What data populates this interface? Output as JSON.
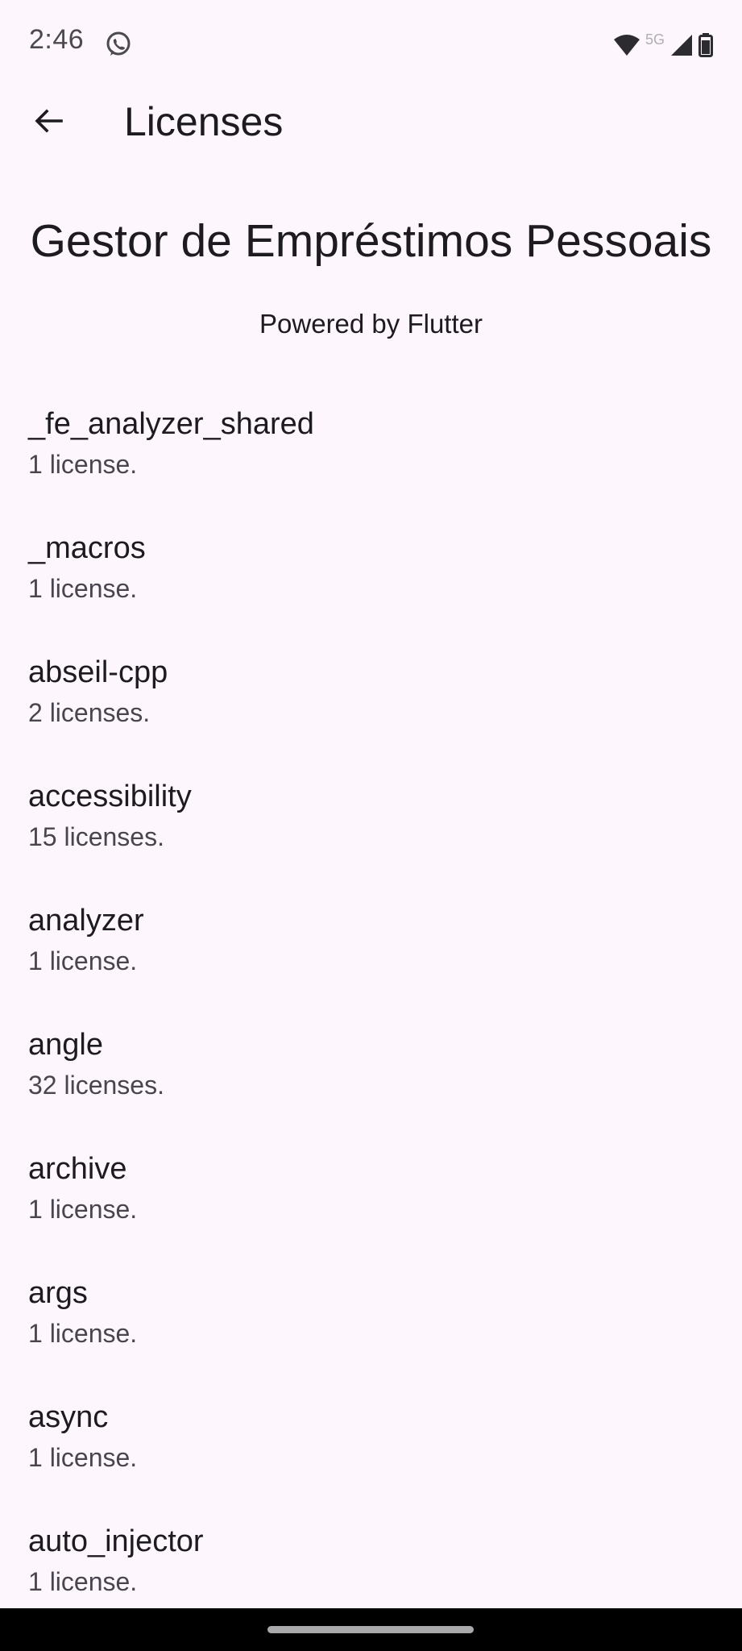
{
  "status_bar": {
    "time": "2:46",
    "app_icon": "whatsapp-icon",
    "network_label": "5G",
    "icons": [
      "wifi-icon",
      "signal-icon",
      "battery-icon"
    ]
  },
  "app_bar": {
    "back_icon": "arrow-back-icon",
    "title": "Licenses"
  },
  "header": {
    "app_name": "Gestor de Empréstimos Pessoais",
    "powered_by": "Powered by Flutter"
  },
  "licenses": [
    {
      "name": "_fe_analyzer_shared",
      "count": "1 license."
    },
    {
      "name": "_macros",
      "count": "1 license."
    },
    {
      "name": "abseil-cpp",
      "count": "2 licenses."
    },
    {
      "name": "accessibility",
      "count": "15 licenses."
    },
    {
      "name": "analyzer",
      "count": "1 license."
    },
    {
      "name": "angle",
      "count": "32 licenses."
    },
    {
      "name": "archive",
      "count": "1 license."
    },
    {
      "name": "args",
      "count": "1 license."
    },
    {
      "name": "async",
      "count": "1 license."
    },
    {
      "name": "auto_injector",
      "count": "1 license."
    }
  ],
  "colors": {
    "background": "#fdf7fd",
    "text_primary": "#1d1b20",
    "text_secondary": "#49454f",
    "nav_bar": "#000000"
  }
}
